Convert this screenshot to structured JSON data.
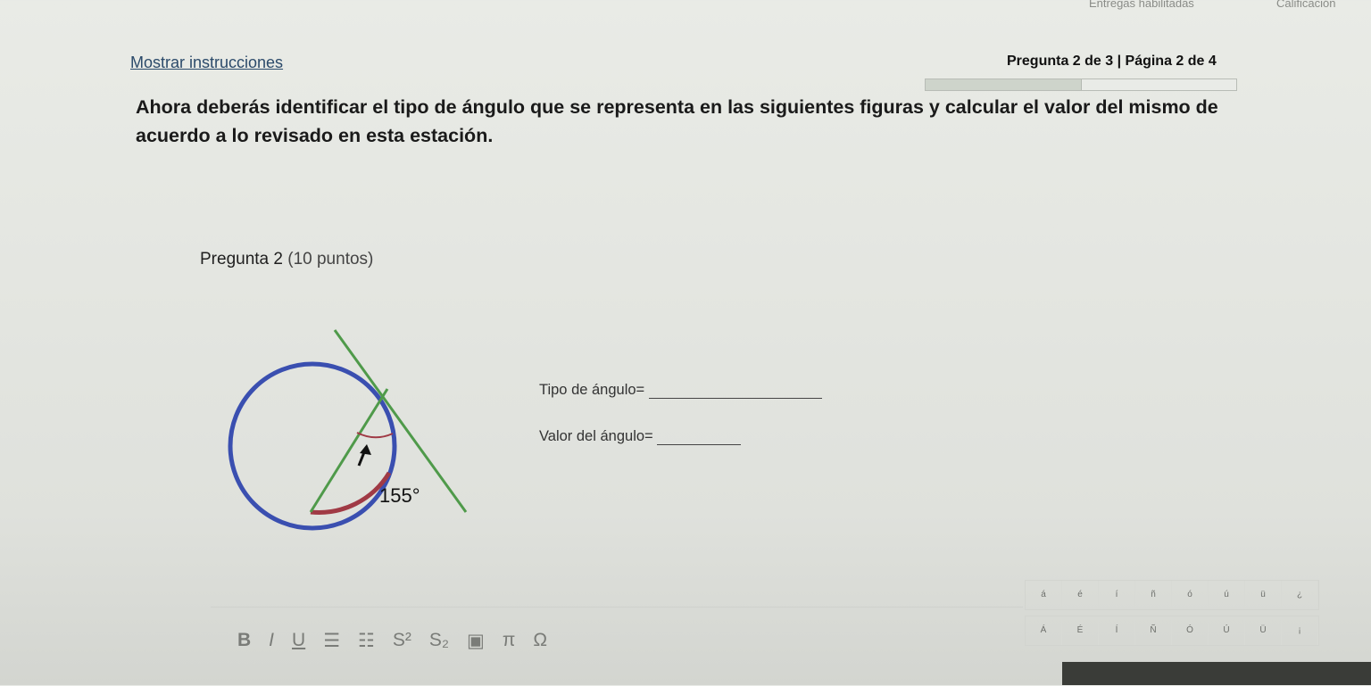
{
  "header": {
    "entregas": "Entregas habilitadas",
    "calificacion": "Calificación"
  },
  "nav": {
    "show_instructions": "Mostrar instrucciones",
    "page_info": "Pregunta 2 de 3 | Página 2 de 4",
    "progress_fraction": 0.5
  },
  "instructions": "Ahora deberás identificar el tipo de ángulo que se representa en las siguientes figuras y calcular el valor del mismo de acuerdo a lo revisado en esta estación.",
  "question": {
    "title": "Pregunta 2",
    "points": "(10 puntos)",
    "angle_label": "155°",
    "type_label": "Tipo de ángulo=",
    "value_label": "Valor del ángulo="
  },
  "editor": {
    "bold": "B",
    "italic": "I",
    "underline": "U",
    "superscript": "S²",
    "subscript": "S₂",
    "pi": "π",
    "omega": "Ω"
  },
  "special_chars": {
    "row1": [
      "á",
      "é",
      "í",
      "ñ",
      "ó",
      "ú",
      "ü",
      "¿"
    ],
    "row2": [
      "Á",
      "É",
      "Í",
      "Ñ",
      "Ó",
      "Ú",
      "Ü",
      "¡"
    ]
  },
  "colors": {
    "circle": "#3a4fb0",
    "arc": "#a03a45",
    "lines": "#4f9a4a"
  }
}
